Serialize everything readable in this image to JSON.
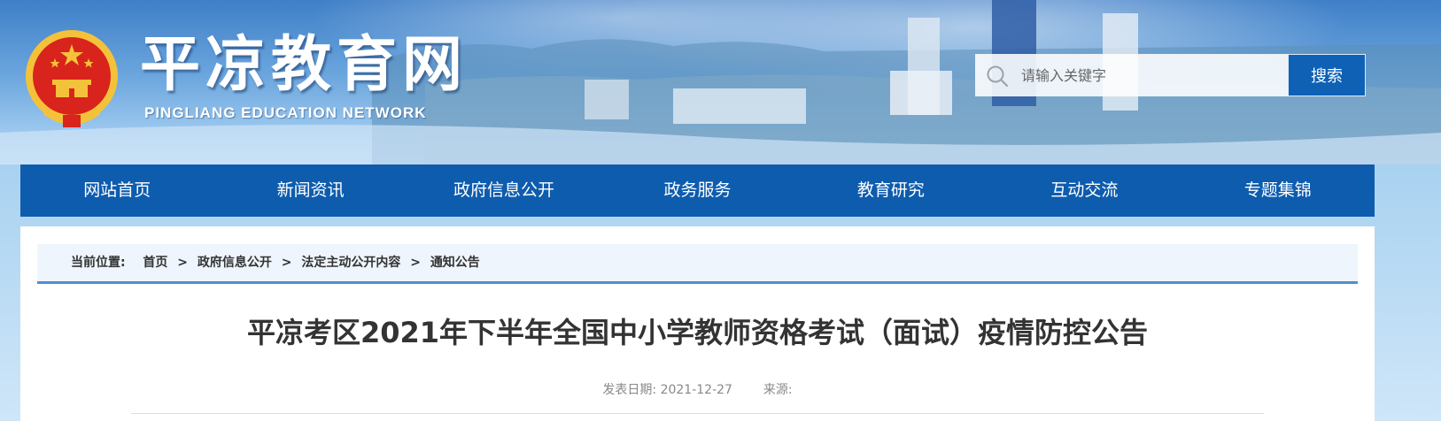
{
  "header": {
    "title": "平凉教育网",
    "subtitle": "PINGLIANG EDUCATION NETWORK",
    "emblem_icon": "national-emblem-icon"
  },
  "search": {
    "placeholder": "请输入关键字",
    "value": "",
    "button_label": "搜索",
    "icon": "search-icon"
  },
  "nav": {
    "items": [
      {
        "label": "网站首页"
      },
      {
        "label": "新闻资讯"
      },
      {
        "label": "政府信息公开"
      },
      {
        "label": "政务服务"
      },
      {
        "label": "教育研究"
      },
      {
        "label": "互动交流"
      },
      {
        "label": "专题集锦"
      }
    ]
  },
  "breadcrumb": {
    "prefix": "当前位置:",
    "separator": ">",
    "items": [
      {
        "label": "首页"
      },
      {
        "label": "政府信息公开"
      },
      {
        "label": "法定主动公开内容"
      },
      {
        "label": "通知公告"
      }
    ]
  },
  "article": {
    "title": "平凉考区2021年下半年全国中小学教师资格考试（面试）疫情防控公告",
    "date_label": "发表日期:",
    "date": "2021-12-27",
    "source_label": "来源:",
    "source": ""
  },
  "colors": {
    "nav_bg": "#0e5cae",
    "search_button_bg": "#0f61b5",
    "breadcrumb_border": "#4d8fd0",
    "emblem_red": "#d8241c",
    "emblem_gold": "#f4c23a"
  }
}
